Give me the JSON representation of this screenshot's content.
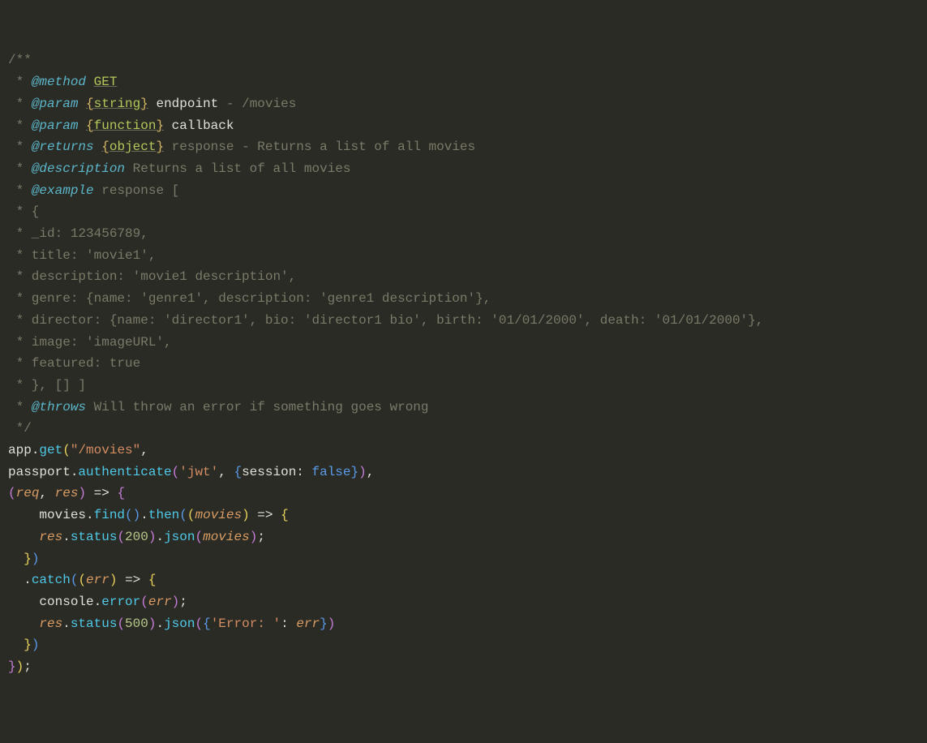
{
  "lines": {
    "l1": "/**",
    "l2_star": " * ",
    "l2_tag": "@method",
    "l2_rest": " ",
    "l2_method": "GET",
    "l3_star": " * ",
    "l3_tag": "@param",
    "l3_sp": " ",
    "l3_ob": "{",
    "l3_type": "string",
    "l3_cb": "}",
    "l3_sp2": " ",
    "l3_name": "endpoint",
    "l3_desc": " - /movies",
    "l4_star": " * ",
    "l4_tag": "@param",
    "l4_sp": " ",
    "l4_ob": "{",
    "l4_type": "function",
    "l4_cb": "}",
    "l4_sp2": " ",
    "l4_name": "callback",
    "l5_star": " * ",
    "l5_tag": "@returns",
    "l5_sp": " ",
    "l5_ob": "{",
    "l5_type": "object",
    "l5_cb": "}",
    "l5_desc": " response - Returns a list of all movies",
    "l6_star": " * ",
    "l6_tag": "@description",
    "l6_desc": " Returns a list of all movies",
    "l7_star": " * ",
    "l7_tag": "@example",
    "l7_desc": " response [",
    "l8": " * {",
    "l9": " * _id: 123456789,",
    "l10": " * title: 'movie1',",
    "l11": " * description: 'movie1 description',",
    "l12": " * genre: {name: 'genre1', description: 'genre1 description'},",
    "l13": " * director: {name: 'director1', bio: 'director1 bio', birth: '01/01/2000', death: '01/01/2000'},",
    "l14": " * image: 'imageURL',",
    "l15": " * featured: true",
    "l16": " * }, [] ]",
    "l17_star": " * ",
    "l17_tag": "@throws",
    "l17_desc": " Will throw an error if something goes wrong",
    "l18": " */",
    "c1_app": "app",
    "c1_dot": ".",
    "c1_get": "get",
    "c1_op": "(",
    "c1_str": "\"/movies\"",
    "c1_comma": ",",
    "c2_passport": "passport",
    "c2_dot": ".",
    "c2_auth": "authenticate",
    "c2_op": "(",
    "c2_str": "'jwt'",
    "c2_comma": ", ",
    "c2_ob": "{",
    "c2_session": "session",
    "c2_colon": ": ",
    "c2_false": "false",
    "c2_cb": "}",
    "c2_cp": ")",
    "c2_comma2": ",",
    "c3_op": "(",
    "c3_req": "req",
    "c3_comma": ", ",
    "c3_res": "res",
    "c3_cp": ")",
    "c3_arrow": " => ",
    "c3_ob": "{",
    "c4_indent": "    ",
    "c4_movies": "movies",
    "c4_dot": ".",
    "c4_find": "find",
    "c4_op": "(",
    "c4_cp": ")",
    "c4_dot2": ".",
    "c4_then": "then",
    "c4_op2": "(",
    "c4_op3": "(",
    "c4_moviesparam": "movies",
    "c4_cp3": ")",
    "c4_arrow": " => ",
    "c4_ob": "{",
    "c5_indent": "    ",
    "c5_res": "res",
    "c5_dot": ".",
    "c5_status": "status",
    "c5_op": "(",
    "c5_200": "200",
    "c5_cp": ")",
    "c5_dot2": ".",
    "c5_json": "json",
    "c5_op2": "(",
    "c5_movies": "movies",
    "c5_cp2": ")",
    "c5_semi": ";",
    "c6_indent": "  ",
    "c6_cb": "}",
    "c6_cp": ")",
    "c7_indent": "  ",
    "c7_dot": ".",
    "c7_catch": "catch",
    "c7_op": "(",
    "c7_op2": "(",
    "c7_err": "err",
    "c7_cp2": ")",
    "c7_arrow": " => ",
    "c7_ob": "{",
    "c8_indent": "    ",
    "c8_console": "console",
    "c8_dot": ".",
    "c8_error": "error",
    "c8_op": "(",
    "c8_err": "err",
    "c8_cp": ")",
    "c8_semi": ";",
    "c9_indent": "    ",
    "c9_res": "res",
    "c9_dot": ".",
    "c9_status": "status",
    "c9_op": "(",
    "c9_500": "500",
    "c9_cp": ")",
    "c9_dot2": ".",
    "c9_json": "json",
    "c9_op2": "(",
    "c9_ob": "{",
    "c9_str": "'Error: '",
    "c9_colon": ": ",
    "c9_err": "err",
    "c9_cb": "}",
    "c9_cp2": ")",
    "c10_indent": "  ",
    "c10_cb": "}",
    "c10_cp": ")",
    "c11_cb": "}",
    "c11_cp": ")",
    "c11_semi": ";"
  }
}
